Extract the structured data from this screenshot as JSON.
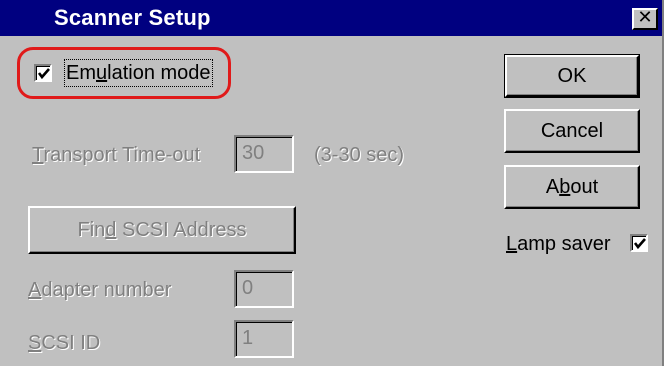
{
  "window": {
    "title": "Scanner Setup",
    "close_glyph": "✕"
  },
  "emulation": {
    "label_pre": "E",
    "label_mn": "m",
    "label_u": "u",
    "label_post": "lation mode",
    "checked": true
  },
  "transport": {
    "label_mn": "T",
    "label_post": "ransport Time-out",
    "value": "30",
    "hint": "(3-30 sec)"
  },
  "find_scsi": {
    "label_pre": "Fin",
    "label_mn": "d",
    "label_post": " SCSI Address"
  },
  "adapter": {
    "label_mn": "A",
    "label_post": "dapter number",
    "value": "0"
  },
  "scsi_id": {
    "label_mn": "S",
    "label_post": "CSI ID",
    "value": "1"
  },
  "buttons": {
    "ok": "OK",
    "cancel": "Cancel",
    "about_pre": "A",
    "about_mn": "b",
    "about_post": "out"
  },
  "lamp_saver": {
    "label_mn": "L",
    "label_post": "amp saver",
    "checked": true
  },
  "icons": {
    "checkmark": "checkmark-icon",
    "close": "close-icon"
  },
  "colors": {
    "title_bar": "#000080",
    "face": "#c0c0c0",
    "highlight_ring": "#e01a1a",
    "disabled_text": "#808080"
  }
}
